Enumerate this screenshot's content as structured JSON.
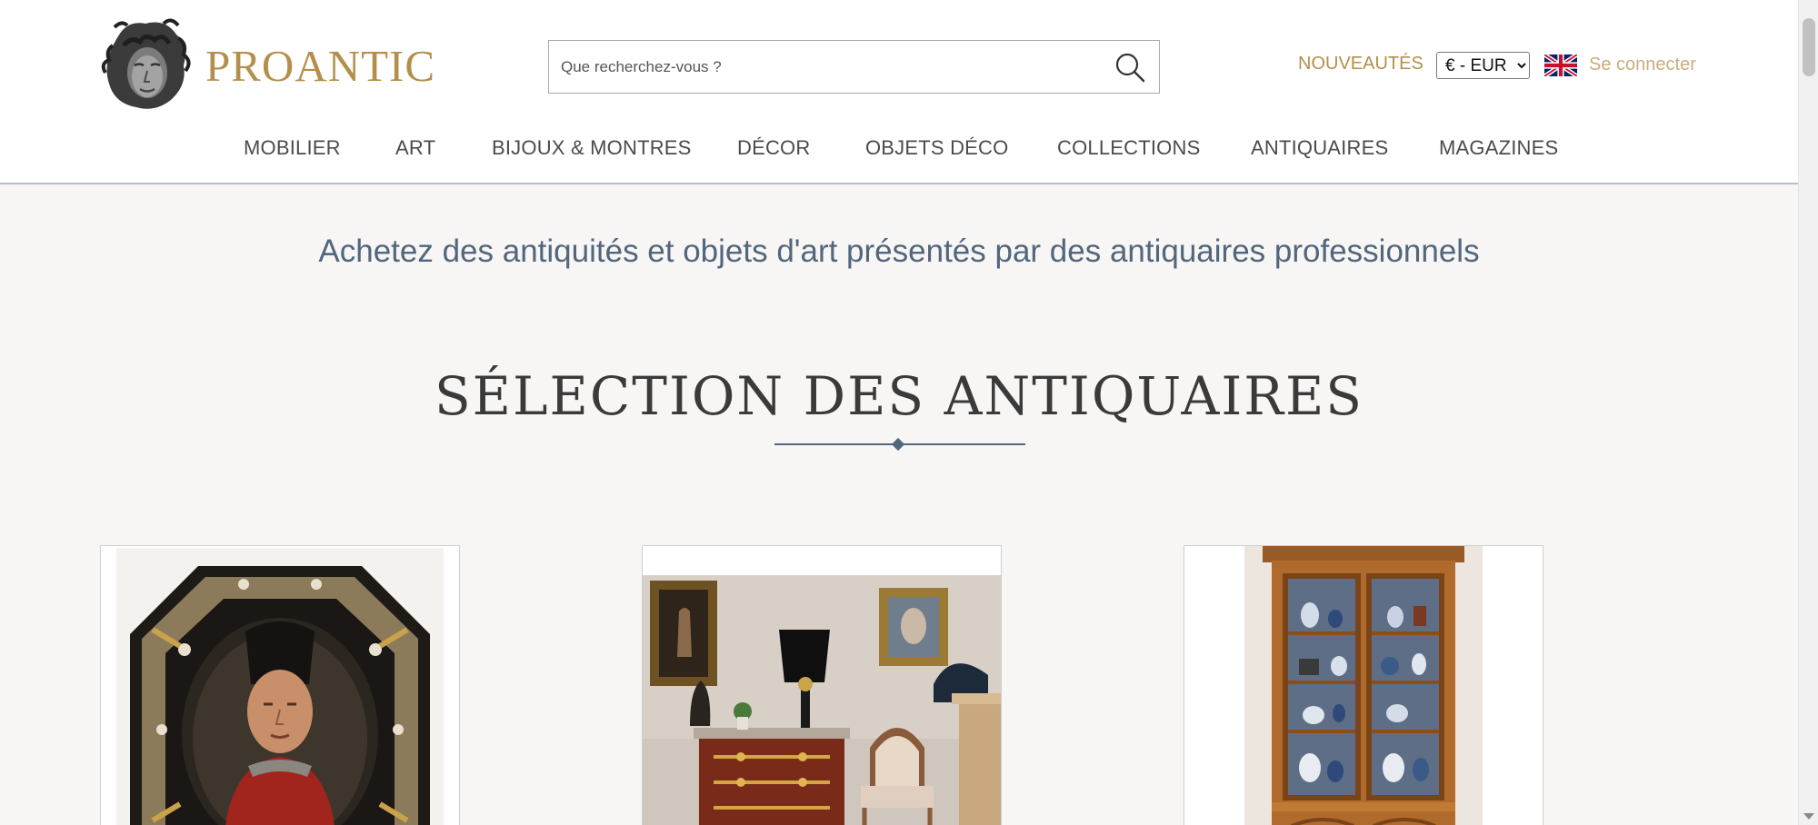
{
  "header": {
    "logo_text": "PROANTIC",
    "search": {
      "placeholder": "Que recherchez-vous ?",
      "value": ""
    },
    "nouveautes_label": "NOUVEAUTÉS",
    "currency": {
      "selected": "€ - EUR",
      "options": [
        "€ - EUR"
      ]
    },
    "language_icon": "uk-flag-icon",
    "login_label": "Se connecter"
  },
  "nav": {
    "items": [
      {
        "label": "MOBILIER"
      },
      {
        "label": "ART"
      },
      {
        "label": "BIJOUX & MONTRES"
      },
      {
        "label": "DÉCOR"
      },
      {
        "label": "OBJETS DÉCO"
      },
      {
        "label": "COLLECTIONS"
      },
      {
        "label": "ANTIQUAIRES"
      },
      {
        "label": "MAGAZINES"
      }
    ]
  },
  "main": {
    "tagline": "Achetez des antiquités et objets d'art présentés par des antiquaires professionnels",
    "section_title": "SÉLECTION DES ANTIQUAIRES",
    "cards": [
      {
        "image": "octagonal-framed-portrait-painting"
      },
      {
        "image": "interior-with-commode-and-paintings"
      },
      {
        "image": "wooden-display-cabinet"
      }
    ]
  },
  "colors": {
    "brand_gold": "#b48f4c",
    "login_gold": "#c9ad7e",
    "tagline_blue": "#52667e",
    "background": "#f7f6f4"
  }
}
